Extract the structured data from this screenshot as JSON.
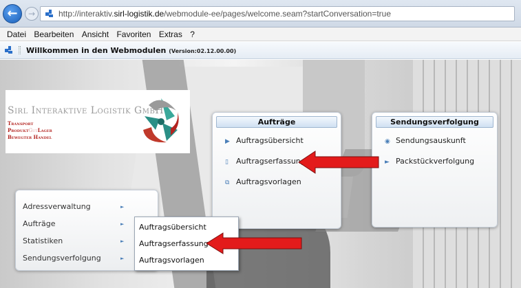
{
  "browser": {
    "back_glyph": "←",
    "forward_glyph": "→",
    "url_prefix": "http://interaktiv.",
    "url_host": "sirl-logistik.de",
    "url_path": "/webmodule-ee/pages/welcome.seam?startConversation=true"
  },
  "menubar": [
    "Datei",
    "Bearbeiten",
    "Ansicht",
    "Favoriten",
    "Extras",
    "?"
  ],
  "header": {
    "title": "Willkommen in den Webmodulen",
    "version": "(Version:02.12.00.00)"
  },
  "logo": {
    "name": "Sirl Interaktive Logistik GmbH",
    "line1": "Transport",
    "line2a": "Produkt",
    "line2b": "Gut",
    "line2c": "Lager",
    "line3": "Bewegter Handel"
  },
  "panels": {
    "auftraege": {
      "title": "Aufträge",
      "items": [
        "Auftragsübersicht",
        "Auftragserfassung",
        "Auftragsvorlagen"
      ]
    },
    "sendungsverfolgung": {
      "title": "Sendungsverfolgung",
      "items": [
        "Sendungsauskunft",
        "Packstückverfolgung"
      ]
    }
  },
  "leftmenu": {
    "items": [
      "Adressverwaltung",
      "Aufträge",
      "Statistiken",
      "Sendungsverfolgung"
    ],
    "arrow_glyph": "►"
  },
  "submenu": {
    "items": [
      "Auftragsübersicht",
      "Auftragserfassung",
      "Auftragsvorlagen"
    ]
  },
  "icons": {
    "folder": "folder-icon",
    "document": "document-icon",
    "copy": "copy-icon",
    "binoculars": "binoculars-icon",
    "package": "package-icon"
  },
  "colors": {
    "logo_red": "#b32420",
    "annotation_arrow": "#e31b1b",
    "panel_header": "#cfe0f2"
  }
}
